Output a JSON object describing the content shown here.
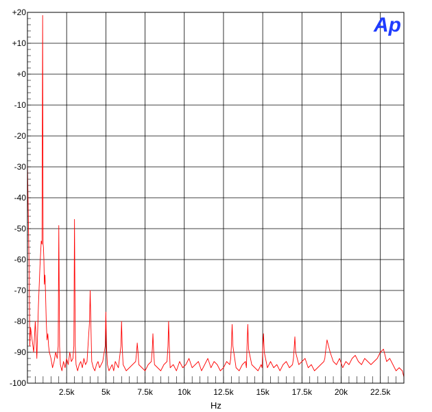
{
  "chart_data": {
    "type": "line",
    "xlabel": "Hz",
    "ylabel": "",
    "xlim": [
      0,
      24000
    ],
    "ylim": [
      -100,
      20
    ],
    "x_ticks": [
      {
        "value": 2500,
        "label": "2.5k"
      },
      {
        "value": 5000,
        "label": "5k"
      },
      {
        "value": 7500,
        "label": "7.5k"
      },
      {
        "value": 10000,
        "label": "10k"
      },
      {
        "value": 12500,
        "label": "12.5k"
      },
      {
        "value": 15000,
        "label": "15k"
      },
      {
        "value": 17500,
        "label": "17.5k"
      },
      {
        "value": 20000,
        "label": "20k"
      },
      {
        "value": 22500,
        "label": "22.5k"
      }
    ],
    "y_ticks": [
      {
        "value": 20,
        "label": "+20"
      },
      {
        "value": 10,
        "label": "+10"
      },
      {
        "value": 0,
        "label": "+0"
      },
      {
        "value": -10,
        "label": "-10"
      },
      {
        "value": -20,
        "label": "-20"
      },
      {
        "value": -30,
        "label": "-30"
      },
      {
        "value": -40,
        "label": "-40"
      },
      {
        "value": -50,
        "label": "-50"
      },
      {
        "value": -60,
        "label": "-60"
      },
      {
        "value": -70,
        "label": "-70"
      },
      {
        "value": -80,
        "label": "-80"
      },
      {
        "value": -90,
        "label": "-90"
      },
      {
        "value": -100,
        "label": "-100"
      }
    ],
    "grid": true,
    "logo_text": "Ap",
    "colors": {
      "series": "#ff0000",
      "grid": "#000000",
      "logo": "#1f3cff"
    },
    "series": [
      {
        "x": [
          0,
          100,
          150,
          200,
          300,
          400,
          500,
          600,
          700,
          800,
          880,
          930,
          970,
          1000,
          1020,
          1050,
          1080,
          1120,
          1160,
          1200,
          1250,
          1300,
          1350,
          1400,
          1500,
          1600,
          1700,
          1800,
          1900,
          1960,
          2000,
          2050,
          2100,
          2200,
          2300,
          2400,
          2500,
          2600,
          2700,
          2800,
          2900,
          2960,
          3000,
          3050,
          3100,
          3200,
          3300,
          3400,
          3500,
          3600,
          3700,
          3800,
          3960,
          4000,
          4050,
          4100,
          4200,
          4300,
          4400,
          4500,
          4600,
          4700,
          4800,
          4960,
          5000,
          5050,
          5100,
          5200,
          5300,
          5400,
          5500,
          5600,
          5700,
          5800,
          5960,
          6000,
          6050,
          6100,
          6300,
          6500,
          6700,
          6900,
          6960,
          7000,
          7050,
          7100,
          7300,
          7500,
          7700,
          7900,
          7960,
          8000,
          8050,
          8100,
          8300,
          8500,
          8700,
          8900,
          8960,
          9000,
          9050,
          9100,
          9300,
          9500,
          9700,
          9900,
          10100,
          10300,
          10500,
          10700,
          10900,
          11100,
          11300,
          11500,
          11700,
          11900,
          12100,
          12300,
          12500,
          12700,
          12900,
          12960,
          13000,
          13050,
          13100,
          13300,
          13500,
          13700,
          13900,
          13960,
          14000,
          14050,
          14100,
          14300,
          14500,
          14700,
          14900,
          14960,
          15000,
          15050,
          15100,
          15300,
          15500,
          15700,
          15900,
          16100,
          16300,
          16500,
          16700,
          16900,
          16960,
          17000,
          17050,
          17100,
          17300,
          17500,
          17700,
          17900,
          18100,
          18300,
          18500,
          18700,
          18900,
          18960,
          19000,
          19050,
          19100,
          19300,
          19500,
          19700,
          19900,
          20100,
          20300,
          20500,
          20700,
          20900,
          21100,
          21300,
          21500,
          21700,
          21900,
          22100,
          22300,
          22500,
          22700,
          22900,
          23100,
          23300,
          23500,
          23700,
          23900,
          24000
        ],
        "y": [
          -28,
          -60,
          -88,
          -82,
          -86,
          -90,
          -80,
          -92,
          -75,
          -62,
          -54,
          -55,
          19,
          -55,
          -56,
          -60,
          -68,
          -65,
          -72,
          -80,
          -86,
          -84,
          -88,
          -90,
          -92,
          -95,
          -93,
          -90,
          -92,
          -88,
          -49,
          -88,
          -94,
          -96,
          -93,
          -95,
          -92,
          -94,
          -90,
          -93,
          -92,
          -88,
          -47,
          -88,
          -94,
          -96,
          -94,
          -93,
          -95,
          -92,
          -94,
          -93,
          -80,
          -70,
          -82,
          -93,
          -95,
          -96,
          -94,
          -93,
          -95,
          -94,
          -93,
          -88,
          -77,
          -89,
          -94,
          -96,
          -95,
          -94,
          -96,
          -93,
          -94,
          -95,
          -88,
          -80,
          -89,
          -94,
          -96,
          -95,
          -94,
          -93,
          -90,
          -87,
          -90,
          -94,
          -95,
          -96,
          -94,
          -93,
          -89,
          -84,
          -90,
          -94,
          -95,
          -96,
          -94,
          -93,
          -88,
          -80,
          -89,
          -95,
          -94,
          -96,
          -93,
          -95,
          -94,
          -92,
          -95,
          -94,
          -93,
          -96,
          -94,
          -92,
          -95,
          -93,
          -94,
          -96,
          -95,
          -93,
          -94,
          -92,
          -88,
          -81,
          -88,
          -95,
          -96,
          -94,
          -93,
          -95,
          -88,
          -81,
          -89,
          -94,
          -95,
          -96,
          -94,
          -95,
          -89,
          -84,
          -90,
          -95,
          -93,
          -95,
          -94,
          -96,
          -94,
          -93,
          -95,
          -94,
          -92,
          -89,
          -85,
          -90,
          -94,
          -93,
          -92,
          -95,
          -94,
          -96,
          -95,
          -94,
          -93,
          -92,
          -90,
          -88,
          -86,
          -90,
          -93,
          -94,
          -92,
          -95,
          -93,
          -94,
          -92,
          -91,
          -93,
          -94,
          -92,
          -93,
          -94,
          -93,
          -92,
          -90,
          -89,
          -93,
          -92,
          -94,
          -96,
          -95,
          -96,
          -98
        ]
      }
    ]
  }
}
